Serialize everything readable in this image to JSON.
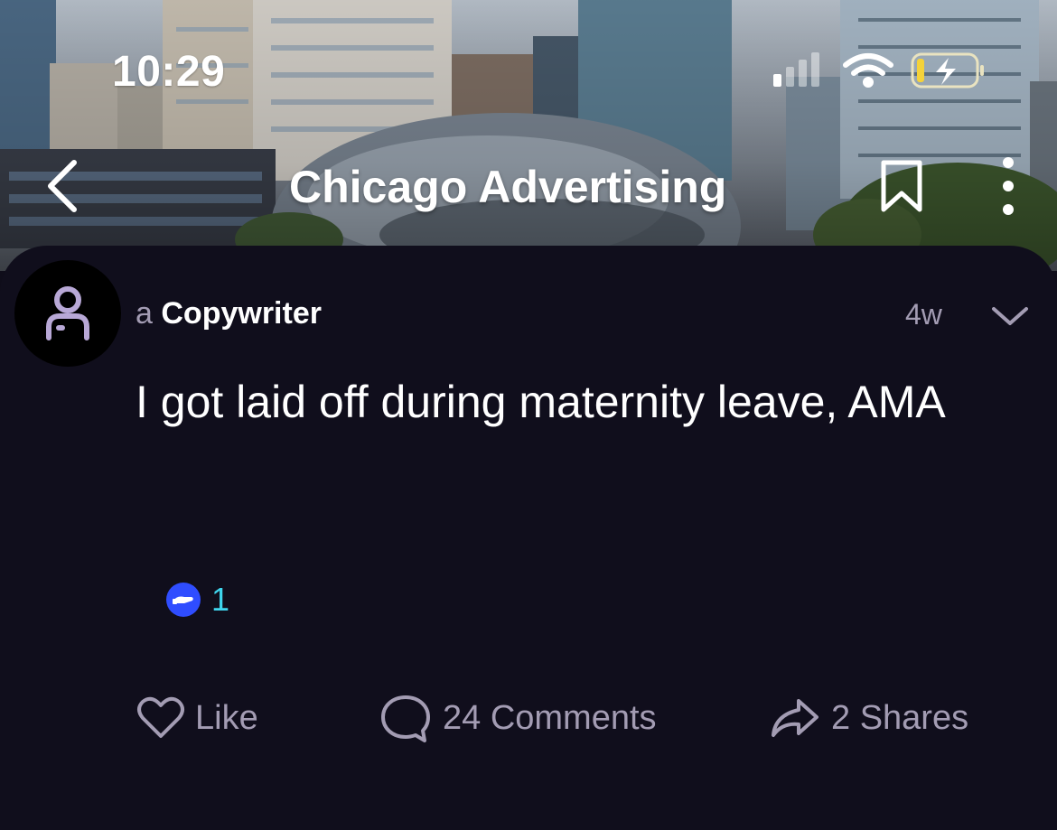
{
  "status_bar": {
    "time": "10:29"
  },
  "header": {
    "title": "Chicago Advertising"
  },
  "post": {
    "author_prefix": "a",
    "author": "Copywriter",
    "age": "4w",
    "title": "I got laid off during maternity leave, AMA",
    "reaction_count": "1"
  },
  "actions": {
    "like": "Like",
    "comments": "24 Comments",
    "shares": "2 Shares"
  },
  "colors": {
    "background": "#100e1c",
    "muted_text": "#a39cb3",
    "reaction_badge": "#2f4dff",
    "reaction_count": "#3fd6ee"
  }
}
